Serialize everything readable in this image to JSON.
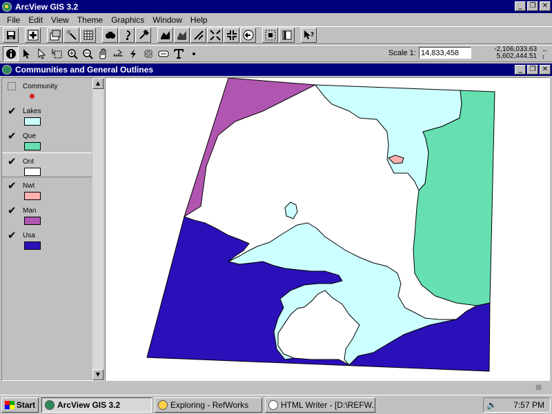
{
  "app": {
    "title": "ArcView GIS 3.2"
  },
  "menu": [
    "File",
    "Edit",
    "View",
    "Theme",
    "Graphics",
    "Window",
    "Help"
  ],
  "toolbar1": [
    "save-icon",
    "add-theme-icon",
    "theme-properties-icon",
    "edit-legend-icon",
    "open-table-icon",
    "find-icon",
    "query-builder-icon",
    "hammer-icon",
    "zoom-full-extent-icon",
    "zoom-active-themes-icon",
    "zoom-selected-icon",
    "zoom-in-fixed-icon",
    "zoom-out-fixed-icon",
    "zoom-previous-icon",
    "select-by-theme-icon",
    "clear-selection-icon",
    "help-icon"
  ],
  "toolbar2": [
    "identify-icon",
    "pointer-icon",
    "vertex-edit-icon",
    "select-feature-icon",
    "zoom-in-icon",
    "zoom-out-icon",
    "pan-icon",
    "measure-icon",
    "hotlink-icon",
    "area-of-interest-icon",
    "label-icon",
    "text-icon",
    "draw-point-icon"
  ],
  "scale": {
    "label": "Scale 1:",
    "value": "14,833,458"
  },
  "coords": {
    "x": "-2,106,033.63",
    "y": "5,602,444.51"
  },
  "document": {
    "title": "Communities and General Outlines"
  },
  "themes": [
    {
      "name": "Community",
      "checked": false,
      "symbol": "point",
      "color": "#d02020"
    },
    {
      "name": "Lakes",
      "checked": true,
      "color": "#ccffff"
    },
    {
      "name": "Que",
      "checked": true,
      "color": "#66e0b0"
    },
    {
      "name": "Ont",
      "checked": true,
      "color": "#ffffff"
    },
    {
      "name": "Nwt",
      "checked": true,
      "color": "#ffb0b0"
    },
    {
      "name": "Man",
      "checked": true,
      "color": "#b055b0"
    },
    {
      "name": "Usa",
      "checked": true,
      "color": "#2a10b8"
    }
  ],
  "taskbar": {
    "start": "Start",
    "tasks": [
      "ArcView GIS 3.2",
      "Exploring - RefWorks",
      "HTML Writer - [D:\\REFW..."
    ],
    "clock": "7:57 PM"
  },
  "glyphs": {
    "check": "✔",
    "min": "_",
    "max": "❐",
    "close": "✕",
    "up": "▲",
    "down": "▼"
  }
}
